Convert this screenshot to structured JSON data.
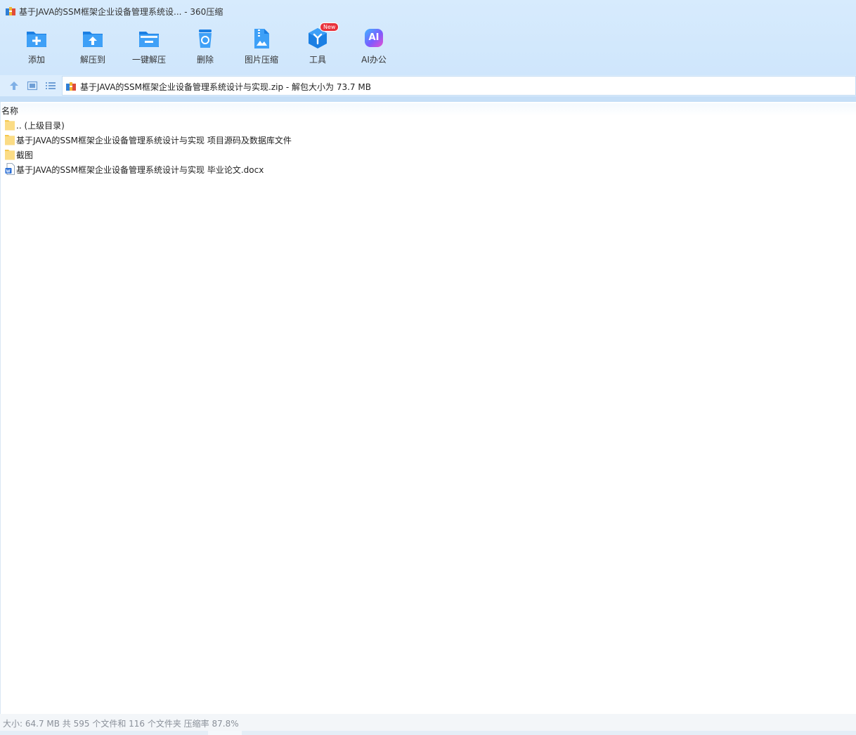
{
  "window": {
    "title": "基于JAVA的SSM框架企业设备管理系统设... - 360压缩"
  },
  "toolbar": {
    "buttons": [
      {
        "label": "添加",
        "icon": "add-icon"
      },
      {
        "label": "解压到",
        "icon": "extract-to-icon"
      },
      {
        "label": "一键解压",
        "icon": "one-click-extract-icon"
      },
      {
        "label": "删除",
        "icon": "delete-icon"
      },
      {
        "label": "图片压缩",
        "icon": "image-compress-icon"
      },
      {
        "label": "工具",
        "icon": "tools-icon",
        "badge": "New"
      },
      {
        "label": "AI办公",
        "icon": "ai-office-icon",
        "icon_text": "AI"
      }
    ]
  },
  "address": {
    "path": "基于JAVA的SSM框架企业设备管理系统设计与实现.zip - 解包大小为 73.7 MB"
  },
  "list": {
    "column_name": "名称",
    "items": [
      {
        "name": ".. (上级目录)",
        "type": "folder"
      },
      {
        "name": "基于JAVA的SSM框架企业设备管理系统设计与实现 项目源码及数据库文件",
        "type": "folder"
      },
      {
        "name": "截图",
        "type": "folder"
      },
      {
        "name": "基于JAVA的SSM框架企业设备管理系统设计与实现 毕业论文.docx",
        "type": "docx"
      }
    ]
  },
  "status": {
    "text": "大小: 64.7 MB 共 595 个文件和 116 个文件夹 压缩率 87.8%"
  },
  "colors": {
    "accent": "#1e8ef0",
    "folder": "#f8d675",
    "badge": "#e8323c"
  }
}
